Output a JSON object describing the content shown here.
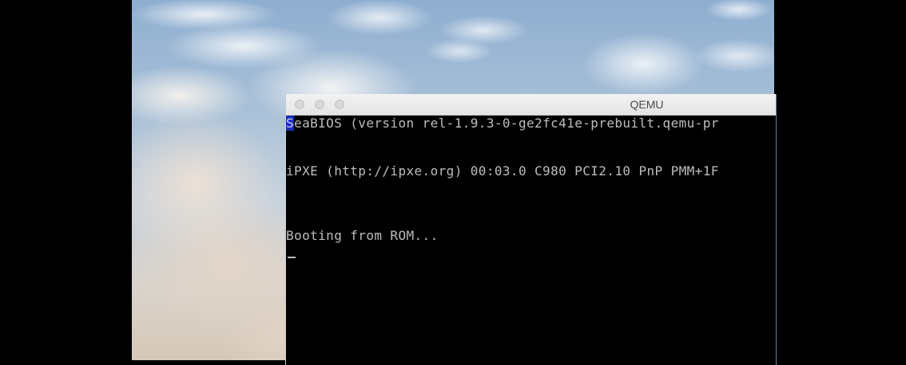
{
  "window": {
    "title": "QEMU"
  },
  "console": {
    "line1_first_char": "S",
    "line1_rest": "eaBIOS (version rel-1.9.3-0-ge2fc41e-prebuilt.qemu-pr",
    "line2": "iPXE (http://ipxe.org) 00:03.0 C980 PCI2.10 PnP PMM+1F",
    "line3": "Booting from ROM..."
  },
  "colors": {
    "console_bg": "#000000",
    "console_text": "#bdbdbd",
    "cursor_highlight": "#1a2fb8",
    "outer_bg": "#000000"
  },
  "icons": {
    "close": "close-icon",
    "minimize": "minimize-icon",
    "zoom": "zoom-icon"
  }
}
